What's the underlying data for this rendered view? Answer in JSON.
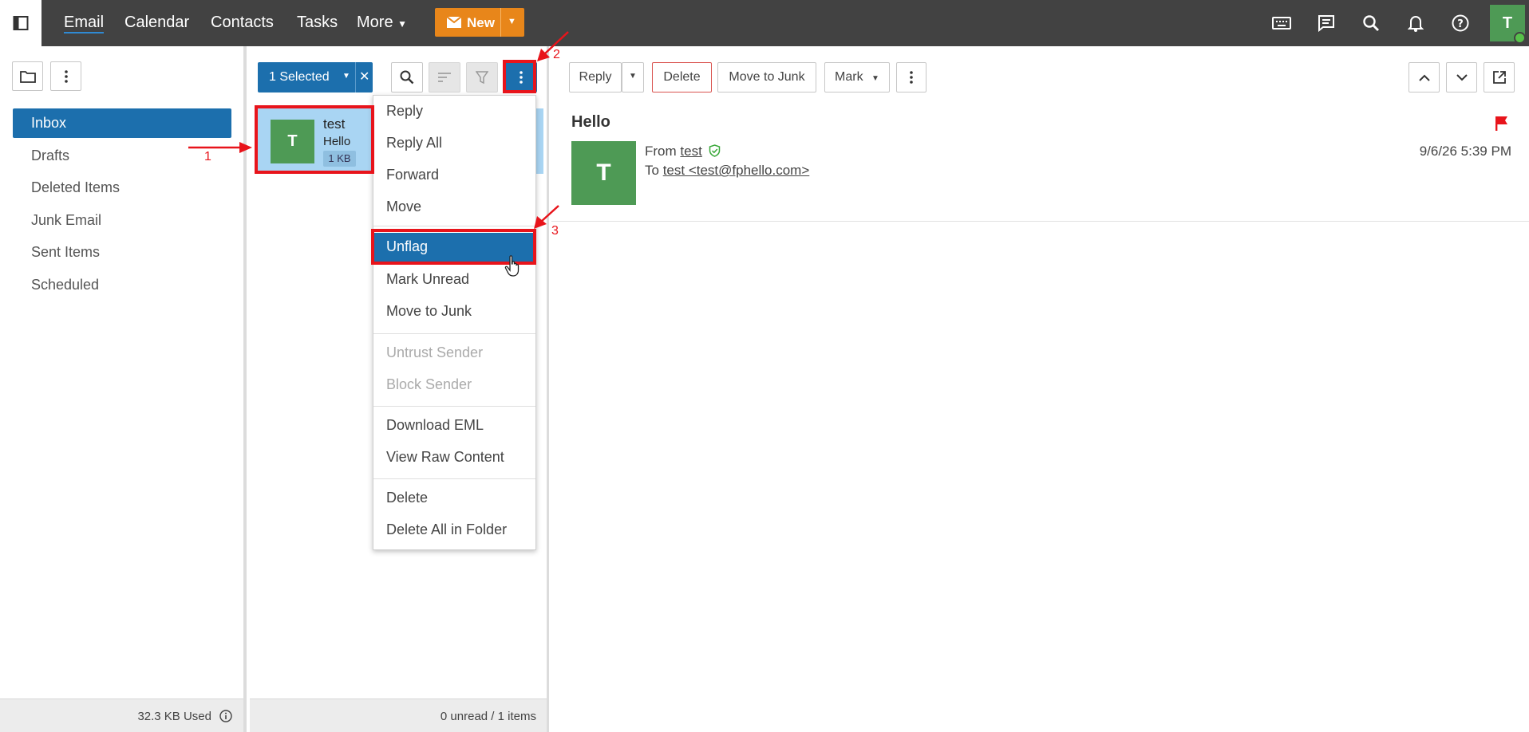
{
  "nav": {
    "items": [
      "Email",
      "Calendar",
      "Contacts",
      "Tasks",
      "More"
    ],
    "new_label": "New"
  },
  "folders": {
    "items": [
      "Inbox",
      "Drafts",
      "Deleted Items",
      "Junk Email",
      "Sent Items",
      "Scheduled"
    ],
    "footer": "32.3 KB Used"
  },
  "list": {
    "selected_label": "1 Selected",
    "message": {
      "avatar": "T",
      "from": "test",
      "subject": "Hello",
      "size": "1 KB"
    },
    "footer": "0 unread / 1 items"
  },
  "menu": {
    "groups": [
      [
        "Reply",
        "Reply All",
        "Forward",
        "Move"
      ],
      [
        "Unflag",
        "Mark Unread",
        "Move to Junk"
      ],
      [
        "Untrust Sender",
        "Block Sender"
      ],
      [
        "Download EML",
        "View Raw Content"
      ],
      [
        "Delete",
        "Delete All in Folder"
      ]
    ],
    "active": "Unflag",
    "disabled": [
      "Untrust Sender",
      "Block Sender"
    ]
  },
  "reading": {
    "reply": "Reply",
    "delete": "Delete",
    "move_to_junk": "Move to Junk",
    "mark": "Mark",
    "subject": "Hello",
    "avatar": "T",
    "from_label": "From",
    "from": "test",
    "to_label": "To",
    "to": "test <test@fphello.com>",
    "date": "9/6/26 5:39 PM"
  },
  "user": {
    "initial": "T"
  },
  "annotations": [
    "1",
    "2",
    "3"
  ],
  "colors": {
    "accent": "#1c6fad",
    "new_button": "#e8861a",
    "highlight": "#e8141b",
    "avatar": "#4e9a55",
    "flag": "#e8141b"
  }
}
